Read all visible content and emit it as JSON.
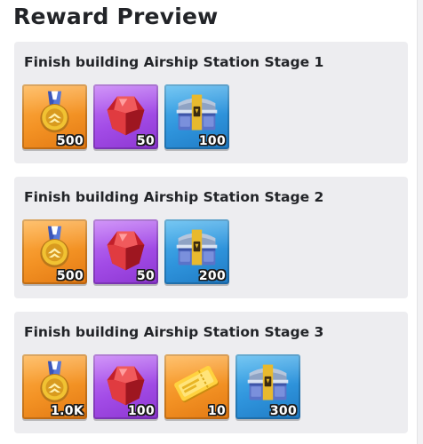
{
  "title": "Reward Preview",
  "stages": [
    {
      "title": "Finish building Airship Station Stage 1",
      "rewards": [
        {
          "icon": "medal-icon",
          "bg": "orange",
          "qty": "500"
        },
        {
          "icon": "ruby-icon",
          "bg": "purple",
          "qty": "50"
        },
        {
          "icon": "chest-icon",
          "bg": "blue",
          "qty": "100"
        }
      ]
    },
    {
      "title": "Finish building Airship Station Stage 2",
      "rewards": [
        {
          "icon": "medal-icon",
          "bg": "orange",
          "qty": "500"
        },
        {
          "icon": "ruby-icon",
          "bg": "purple",
          "qty": "50"
        },
        {
          "icon": "chest-icon",
          "bg": "blue",
          "qty": "200"
        }
      ]
    },
    {
      "title": "Finish building Airship Station Stage 3",
      "rewards": [
        {
          "icon": "medal-icon",
          "bg": "orange",
          "qty": "1.0K"
        },
        {
          "icon": "ruby-icon",
          "bg": "purple",
          "qty": "100"
        },
        {
          "icon": "ticket-icon",
          "bg": "orange",
          "qty": "10"
        },
        {
          "icon": "chest-icon",
          "bg": "blue",
          "qty": "300"
        }
      ]
    }
  ]
}
